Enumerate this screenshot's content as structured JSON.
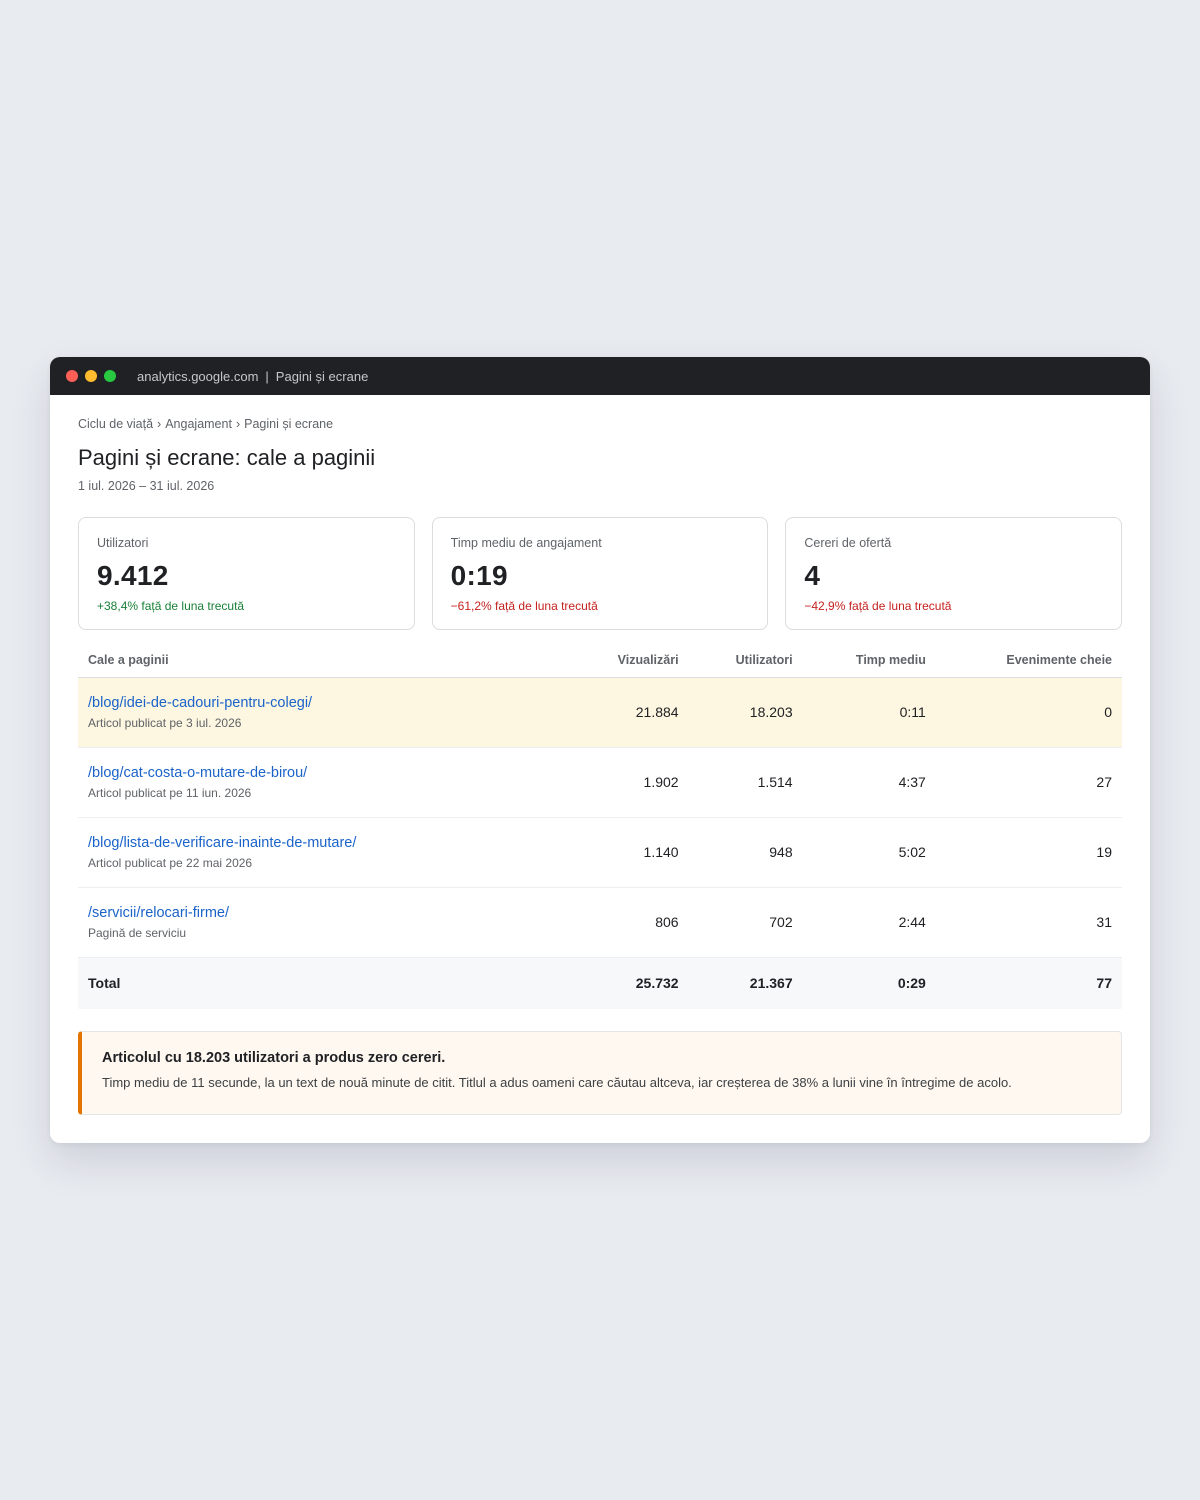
{
  "titlebar": {
    "domain": "analytics.google.com",
    "separator": "|",
    "page": "Pagini și ecrane"
  },
  "breadcrumb": [
    "Ciclu de viață",
    "Angajament",
    "Pagini și ecrane"
  ],
  "breadcrumb_separator": "›",
  "title": "Pagini și ecrane: cale a paginii",
  "date_range": "1 iul. 2026 – 31 iul. 2026",
  "kpis": [
    {
      "label": "Utilizatori",
      "value": "9.412",
      "delta": "+38,4% față de luna trecută",
      "trend": "up",
      "color": "#188038"
    },
    {
      "label": "Timp mediu de angajament",
      "value": "0:19",
      "delta": "−61,2% față de luna trecută",
      "trend": "down",
      "color": "#c5221f"
    },
    {
      "label": "Cereri de ofertă",
      "value": "4",
      "delta": "−42,9% față de luna trecută",
      "trend": "down",
      "color": "#c5221f"
    }
  ],
  "table": {
    "headers": [
      "Cale a paginii",
      "Vizualizări",
      "Utilizatori",
      "Timp mediu",
      "Evenimente cheie"
    ],
    "rows": [
      {
        "path": "/blog/idei-de-cadouri-pentru-colegi/",
        "sub": "Articol publicat pe 3 iul. 2026",
        "views": "21.884",
        "users": "18.203",
        "avg_time": "0:11",
        "key_events": "0",
        "highlighted": true
      },
      {
        "path": "/blog/cat-costa-o-mutare-de-birou/",
        "sub": "Articol publicat pe 11 iun. 2026",
        "views": "1.902",
        "users": "1.514",
        "avg_time": "4:37",
        "key_events": "27",
        "highlighted": false
      },
      {
        "path": "/blog/lista-de-verificare-inainte-de-mutare/",
        "sub": "Articol publicat pe 22 mai 2026",
        "views": "1.140",
        "users": "948",
        "avg_time": "5:02",
        "key_events": "19",
        "highlighted": false
      },
      {
        "path": "/servicii/relocari-firme/",
        "sub": "Pagină de serviciu",
        "views": "806",
        "users": "702",
        "avg_time": "2:44",
        "key_events": "31",
        "highlighted": false
      }
    ],
    "total": {
      "label": "Total",
      "views": "25.732",
      "users": "21.367",
      "avg_time": "0:29",
      "key_events": "77"
    }
  },
  "insight": {
    "title": "Articolul cu 18.203 utilizatori a produs zero cereri.",
    "text": "Timp mediu de 11 secunde, la un text de nouă minute de citit. Titlul a adus oameni care căutau altceva, iar creșterea de 38% a lunii vine în întregime de acolo.",
    "accent_color": "#e37400"
  },
  "colors": {
    "link": "#1a63c9",
    "highlight_row": "#fdf6e0",
    "positive": "#188038",
    "negative": "#c5221f"
  }
}
